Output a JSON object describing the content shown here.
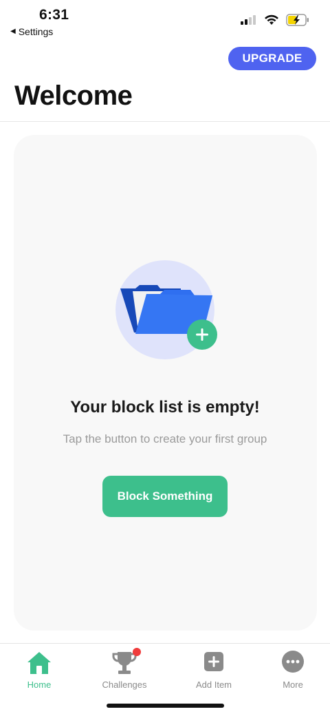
{
  "status_bar": {
    "time": "6:31",
    "back_label": "Settings",
    "icons": [
      "cellular-signal-icon",
      "wifi-icon",
      "battery-charging-icon"
    ]
  },
  "header": {
    "upgrade_label": "UPGRADE",
    "title": "Welcome"
  },
  "empty_state": {
    "illustration": "folder-add-icon",
    "heading": "Your block list is empty!",
    "subtext": "Tap the button to create your first group",
    "button_label": "Block Something"
  },
  "tab_bar": {
    "tabs": [
      {
        "label": "Home",
        "icon": "home-icon",
        "active": true
      },
      {
        "label": "Challenges",
        "icon": "trophy-icon",
        "badge": true
      },
      {
        "label": "Add Item",
        "icon": "add-square-icon"
      },
      {
        "label": "More",
        "icon": "more-icon"
      }
    ]
  },
  "colors": {
    "accent_blue": "#4f63f0",
    "accent_green": "#3dbf8c",
    "badge_red": "#f03c3c"
  }
}
